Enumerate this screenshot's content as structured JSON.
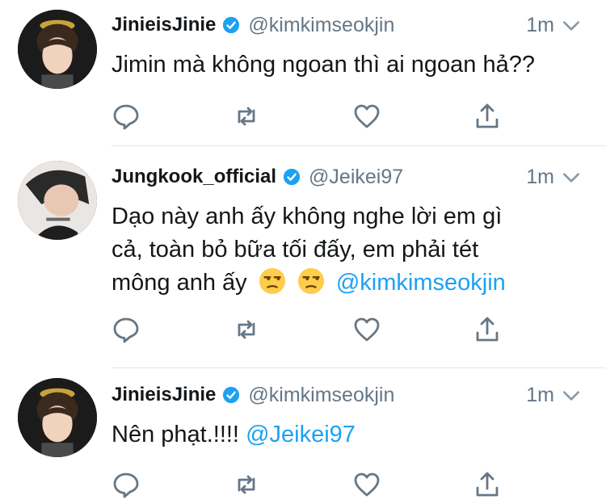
{
  "tweets": [
    {
      "name": "JinieisJinie",
      "handle": "@kimkimseokjin",
      "time": "1m",
      "text": "Jimin mà không ngoan thì ai ngoan hả??"
    },
    {
      "name": "Jungkook_official",
      "handle": "@Jeikei97",
      "time": "1m",
      "text_line1": "Dạo này anh ấy không nghe lời em gì",
      "text_line2": "cả, toàn bỏ bữa tối đấy, em phải tét",
      "text_line3": "mông anh ấy",
      "emoji": "😒 😒",
      "mention": "@kimkimseokjin"
    },
    {
      "name": "JinieisJinie",
      "handle": "@kimkimseokjin",
      "time": "1m",
      "text": "Nên phạt.!!!!",
      "mention": "@Jeikei97"
    }
  ],
  "colors": {
    "text": "#14171a",
    "muted": "#657786",
    "link": "#1da1f2",
    "verified": "#1da1f2",
    "icon": "#657786",
    "divider": "#e1e8ed"
  },
  "icons": [
    "reply-icon",
    "retweet-icon",
    "like-icon",
    "share-icon",
    "verified-badge-icon",
    "chevron-down-icon",
    "unamused-face-emoji"
  ]
}
